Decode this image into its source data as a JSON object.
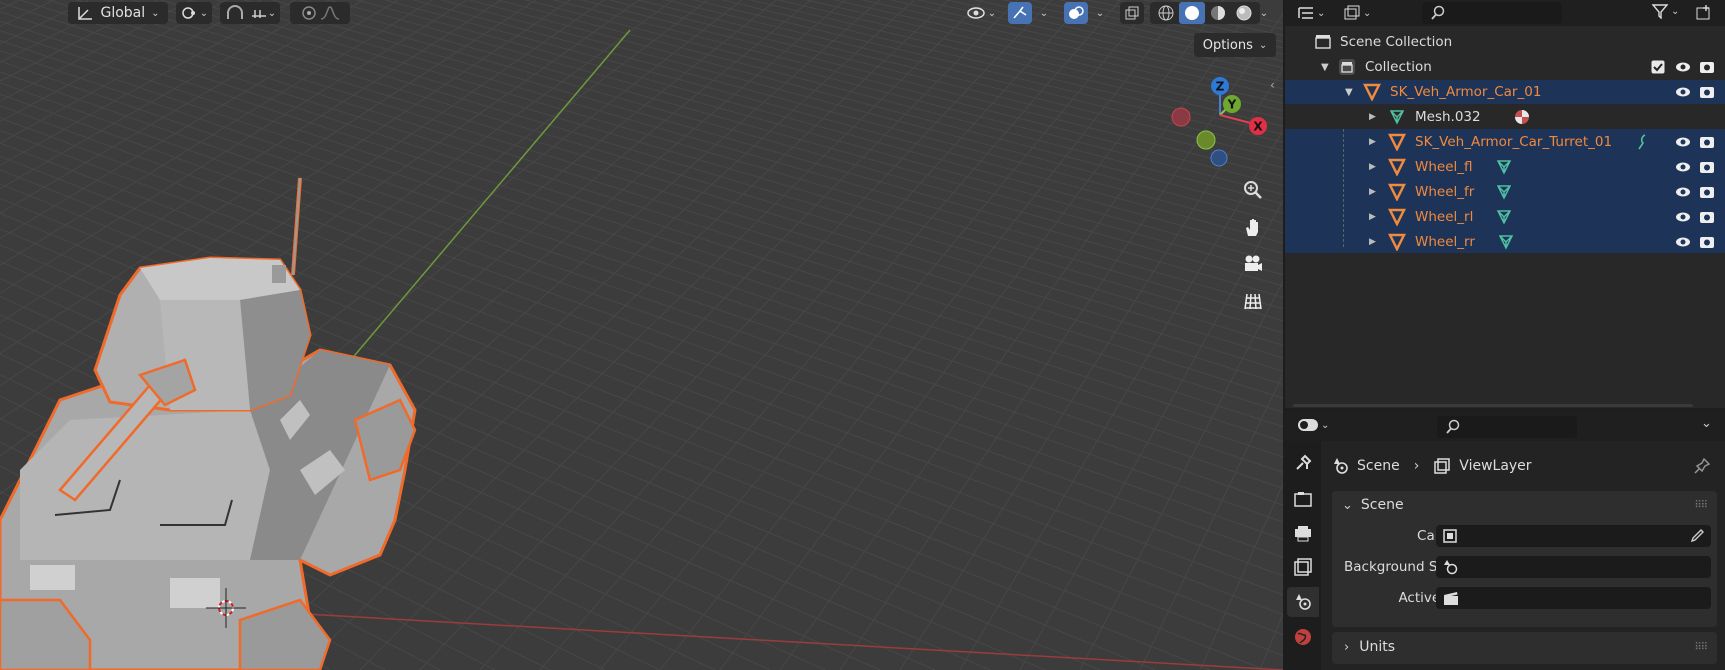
{
  "viewport": {
    "transform_orientation": "Global",
    "options_label": "Options",
    "gizmo_axes": {
      "z": "Z",
      "y": "Y",
      "x": "X"
    },
    "icons": [
      "transform-orientation-icon",
      "snap-icon",
      "proportional-edit-icon",
      "visibility-icon",
      "gizmo-icon",
      "overlay-icon",
      "xray-icon",
      "wireframe-shading-icon",
      "solid-shading-icon",
      "material-shading-icon",
      "rendered-shading-icon",
      "zoom-icon",
      "pan-hand-icon",
      "camera-view-icon",
      "ortho-grid-icon"
    ]
  },
  "outliner": {
    "scene_collection": "Scene Collection",
    "collection": "Collection",
    "items": [
      {
        "label": "SK_Veh_Armor_Car_01"
      },
      {
        "label": "Mesh.032"
      },
      {
        "label": "SK_Veh_Armor_Car_Turret_01"
      },
      {
        "label": "Wheel_fl"
      },
      {
        "label": "Wheel_fr"
      },
      {
        "label": "Wheel_rl"
      },
      {
        "label": "Wheel_rr"
      }
    ]
  },
  "properties": {
    "breadcrumb_scene": "Scene",
    "breadcrumb_viewlayer": "ViewLayer",
    "scene_panel_title": "Scene",
    "camera_label": "Camera",
    "background_scene_label": "Background Scene",
    "active_clip_label": "Active Clip",
    "units_panel_title": "Units"
  },
  "colors": {
    "selection": "#1e3358",
    "object_orange": "#f08a3c",
    "mesh_green": "#4fc0a0",
    "active_blue": "#4772b3"
  }
}
